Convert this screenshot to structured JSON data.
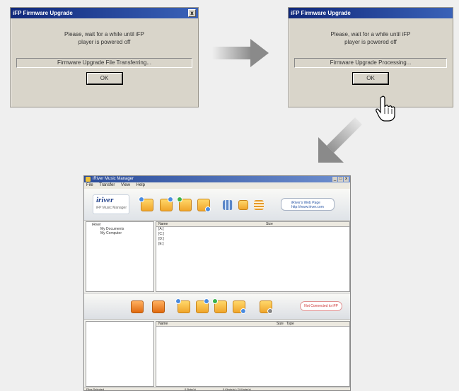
{
  "dialog1": {
    "title": "iFP Firmware Upgrade",
    "close": "x",
    "message_line1": "Please, wait for a while until iFP",
    "message_line2": "player is powered off",
    "status": "Firmware Upgrade File Transferring...",
    "ok": "OK"
  },
  "dialog2": {
    "title": "iFP Firmware Upgrade",
    "message_line1": "Please, wait for a while until iFP",
    "message_line2": "player is powered off",
    "status": "Firmware Upgrade Processing...",
    "ok": "OK"
  },
  "main": {
    "title": "iRiver Music Manager",
    "window_controls": [
      "_",
      "□",
      "x"
    ],
    "menu": [
      "File",
      "Transfer",
      "View",
      "Help"
    ],
    "logo": "iriver",
    "logo_sub": "iFP Music Manager",
    "url_line1": "iRiver's Web Page",
    "url_line2": "http://www.iriver.com",
    "tree": [
      "iRiver",
      "My Documents",
      "My Computer"
    ],
    "top_columns": [
      "Name",
      "Size"
    ],
    "drives": [
      "[A:]",
      "[C:]",
      "[D:]",
      "[E:]"
    ],
    "bottom_columns": [
      "Name",
      "Size",
      "Type"
    ],
    "connect": "Not Connected to iFP",
    "status": [
      "Files Selected",
      "0 Byte(s)",
      "0 Kbyte(s) / 0 Kbyte(s)"
    ]
  },
  "icons": [
    "close-icon",
    "right-arrow-icon",
    "diagonal-arrow-icon",
    "hand-cursor-icon",
    "folder-icon",
    "upload-icon",
    "download-icon",
    "app-icon"
  ],
  "colors": {
    "title_bar": "#10287a",
    "dialog_bg": "#d9d5ca",
    "folder": "#f0a52b",
    "arrow": "#8a8a8a"
  }
}
